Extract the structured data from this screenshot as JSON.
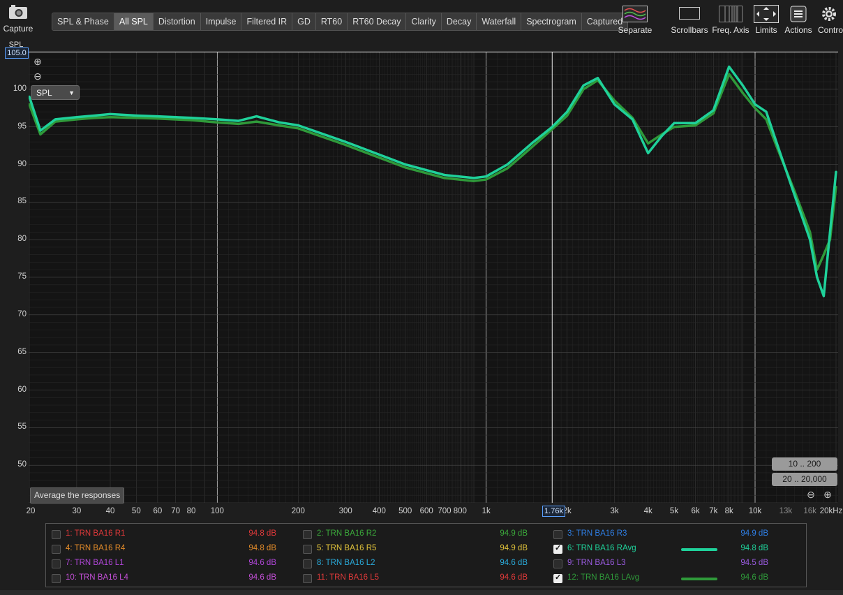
{
  "toolbar": {
    "capture_label": "Capture",
    "tabs": [
      "SPL & Phase",
      "All SPL",
      "Distortion",
      "Impulse",
      "Filtered IR",
      "GD",
      "RT60",
      "RT60 Decay",
      "Clarity",
      "Decay",
      "Waterfall",
      "Spectrogram",
      "Captured"
    ],
    "active_tab": "All SPL",
    "right_tools": [
      "Separate",
      "Scrollbars",
      "Freq. Axis",
      "Limits",
      "Actions",
      "Controls"
    ]
  },
  "plot": {
    "y_axis_label": "SPL",
    "y_max_readout": "105.0",
    "y_ticks": [
      "100",
      "95",
      "90",
      "85",
      "80",
      "75",
      "70",
      "65",
      "60",
      "55",
      "50"
    ],
    "x_ticks": [
      "20",
      "30",
      "40",
      "50",
      "60",
      "70",
      "80",
      "100",
      "200",
      "300",
      "400",
      "500",
      "600",
      "700",
      "800",
      "1k",
      "2k",
      "3k",
      "4k",
      "5k",
      "6k",
      "7k",
      "8k",
      "10k",
      "20kHz"
    ],
    "x_ticks_dim": [
      "13k",
      "16k"
    ],
    "cursor_readout": "1.76k",
    "mode_select": "SPL",
    "average_button": "Average the responses",
    "range_buttons": [
      "10 .. 200",
      "20 .. 20,000"
    ]
  },
  "legend": [
    {
      "n": "1: TRN BA16 R1",
      "val": "94.8 dB",
      "color": "#e0393a",
      "checked": false
    },
    {
      "n": "2: TRN BA16 R2",
      "val": "94.9 dB",
      "color": "#3ba93b",
      "checked": false
    },
    {
      "n": "3: TRN BA16 R3",
      "val": "94.9 dB",
      "color": "#2f7fe6",
      "checked": false
    },
    {
      "n": "4: TRN BA16 R4",
      "val": "94.8 dB",
      "color": "#e08a2a",
      "checked": false
    },
    {
      "n": "5: TRN BA16 R5",
      "val": "94.9 dB",
      "color": "#e0c23a",
      "checked": false
    },
    {
      "n": "6: TRN BA16 RAvg",
      "val": "94.8 dB",
      "color": "#1fd19a",
      "checked": true
    },
    {
      "n": "7: TRN BA16 L1",
      "val": "94.6 dB",
      "color": "#b046d8",
      "checked": false
    },
    {
      "n": "8: TRN BA16 L2",
      "val": "94.6 dB",
      "color": "#2aa9d8",
      "checked": false
    },
    {
      "n": "9: TRN BA16 L3",
      "val": "94.5 dB",
      "color": "#9a5be0",
      "checked": false
    },
    {
      "n": "10: TRN BA16 L4",
      "val": "94.6 dB",
      "color": "#c24fd6",
      "checked": false
    },
    {
      "n": "11: TRN BA16 L5",
      "val": "94.6 dB",
      "color": "#e03a3a",
      "checked": false
    },
    {
      "n": "12: TRN BA16 LAvg",
      "val": "94.6 dB",
      "color": "#2f9a3a",
      "checked": true
    }
  ],
  "chart_data": {
    "type": "line",
    "ylabel": "SPL",
    "ylim": [
      45,
      105
    ],
    "xlim": [
      20,
      20000
    ],
    "x_scale": "log",
    "grid": true,
    "series": [
      {
        "name": "6: TRN BA16 RAvg",
        "color": "#1fd19a",
        "x": [
          20,
          22,
          25,
          30,
          35,
          40,
          50,
          60,
          80,
          100,
          120,
          140,
          170,
          200,
          300,
          500,
          700,
          900,
          1000,
          1200,
          1500,
          1760,
          2000,
          2300,
          2600,
          3000,
          3500,
          4000,
          4500,
          5000,
          6000,
          7000,
          8000,
          9000,
          10000,
          11000,
          12000,
          14000,
          16000,
          17000,
          18000,
          19000,
          20000
        ],
        "y": [
          99,
          94.5,
          96,
          96.3,
          96.5,
          96.7,
          96.5,
          96.4,
          96.2,
          96,
          95.8,
          96.4,
          95.6,
          95.2,
          93,
          90,
          88.6,
          88.2,
          88.4,
          90,
          93,
          95,
          97,
          100.5,
          101.5,
          98,
          96,
          91.5,
          93.8,
          95.5,
          95.5,
          97.2,
          103,
          100.5,
          98,
          97,
          93,
          86,
          80,
          75,
          72.5,
          81,
          89
        ]
      },
      {
        "name": "12: TRN BA16 LAvg",
        "color": "#2f9a3a",
        "x": [
          20,
          22,
          25,
          30,
          35,
          40,
          50,
          60,
          80,
          100,
          120,
          140,
          170,
          200,
          300,
          500,
          700,
          900,
          1000,
          1200,
          1500,
          1760,
          2000,
          2300,
          2600,
          3000,
          3500,
          4000,
          4500,
          5000,
          6000,
          7000,
          8000,
          9000,
          10000,
          11000,
          12000,
          14000,
          16000,
          17000,
          18000,
          19000,
          20000
        ],
        "y": [
          98,
          94,
          95.7,
          96,
          96.2,
          96.3,
          96.2,
          96.1,
          95.9,
          95.6,
          95.4,
          95.7,
          95.2,
          94.8,
          92.6,
          89.6,
          88.2,
          87.8,
          88,
          89.5,
          92.5,
          94.7,
          96.5,
          100,
          101.2,
          98.5,
          96.2,
          92.8,
          94,
          95,
          95.2,
          96.8,
          102,
          99.5,
          97.5,
          96,
          92.5,
          86.5,
          81,
          76,
          78,
          80,
          87
        ]
      }
    ]
  }
}
